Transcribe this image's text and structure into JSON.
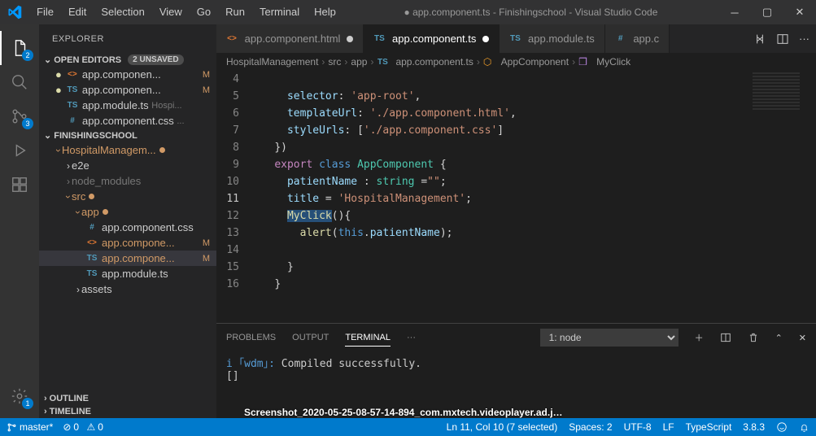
{
  "menu": {
    "items": [
      "File",
      "Edit",
      "Selection",
      "View",
      "Go",
      "Run",
      "Terminal",
      "Help"
    ]
  },
  "title": "● app.component.ts - Finishingschool - Visual Studio Code",
  "activity": {
    "explorer_badge": "2",
    "scm_badge": "3",
    "settings_badge": "1"
  },
  "sidebar": {
    "title": "EXPLORER",
    "open_editors": {
      "label": "OPEN EDITORS",
      "unsaved": "2 UNSAVED",
      "items": [
        {
          "dirty": true,
          "tag": "<>",
          "tagcls": "tag-html",
          "name": "app.componen...",
          "m": "M"
        },
        {
          "dirty": true,
          "tag": "TS",
          "tagcls": "tag-ts",
          "name": "app.componen...",
          "m": "M"
        },
        {
          "dirty": false,
          "tag": "TS",
          "tagcls": "tag-ts",
          "name": "app.module.ts",
          "suffix": "Hospi..."
        },
        {
          "dirty": false,
          "tag": "#",
          "tagcls": "tag-hash",
          "name": "app.component.css",
          "suffix": "..."
        }
      ]
    },
    "project": {
      "label": "FINISHINGSCHOOL",
      "root": "HospitalManagem...",
      "tree": {
        "e2e": "e2e",
        "node_modules": "node_modules",
        "src": "src",
        "app": "app",
        "files": [
          {
            "tag": "#",
            "tagcls": "tag-hash",
            "name": "app.component.css"
          },
          {
            "tag": "<>",
            "tagcls": "tag-html",
            "name": "app.compone...",
            "m": "M"
          },
          {
            "tag": "TS",
            "tagcls": "tag-ts",
            "name": "app.compone...",
            "m": "M",
            "selected": true
          },
          {
            "tag": "TS",
            "tagcls": "tag-ts",
            "name": "app.module.ts"
          }
        ],
        "assets": "assets"
      }
    },
    "outline": "OUTLINE",
    "timeline": "TIMELINE"
  },
  "tabs": {
    "items": [
      {
        "tag": "<>",
        "tagcls": "tag-html",
        "name": "app.component.html",
        "dirty": true,
        "active": false
      },
      {
        "tag": "TS",
        "tagcls": "tag-ts",
        "name": "app.component.ts",
        "dirty": true,
        "active": true
      },
      {
        "tag": "TS",
        "tagcls": "tag-ts",
        "name": "app.module.ts",
        "dirty": false,
        "active": false
      },
      {
        "tag": "#",
        "tagcls": "tag-hash",
        "name": "app.c",
        "dirty": false,
        "active": false
      }
    ]
  },
  "breadcrumb": [
    "HospitalManagement",
    "src",
    "app",
    "app.component.ts",
    "AppComponent",
    "MyClick"
  ],
  "code": {
    "lines": [
      4,
      5,
      6,
      7,
      8,
      9,
      10,
      11,
      12,
      13,
      14,
      15,
      16
    ],
    "current_line": 11,
    "l4": {
      "a": "selector",
      "b": ": ",
      "c": "'app-root'",
      "d": ","
    },
    "l5": {
      "a": "templateUrl",
      "b": ": ",
      "c": "'./app.component.html'",
      "d": ","
    },
    "l6": {
      "a": "styleUrls",
      "b": ": [",
      "c": "'./app.component.css'",
      "d": "]"
    },
    "l7": "})",
    "l8": {
      "a": "export",
      "b": "class",
      "c": "AppComponent",
      "d": "{"
    },
    "l9": {
      "a": "patientName",
      "b": " : ",
      "c": "string",
      "d": " =",
      "e": "\"\"",
      "f": ";"
    },
    "l10": {
      "a": "title",
      "b": " = ",
      "c": "'HospitalManagement'",
      "d": ";"
    },
    "l11": {
      "a": "MyClick",
      "b": "(){"
    },
    "l12": {
      "a": "alert",
      "b": "(",
      "c": "this",
      "d": ".",
      "e": "patientName",
      "f": ");"
    },
    "l14": "}",
    "l15": "}"
  },
  "panel": {
    "tabs": {
      "problems": "PROBLEMS",
      "output": "OUTPUT",
      "terminal": "TERMINAL"
    },
    "term_select": "1: node",
    "body_prefix": "i ｢wdm｣:",
    "body": " Compiled successfully.",
    "cursor": "[]"
  },
  "status": {
    "branch": "master*",
    "errors": "0",
    "warnings": "0",
    "pos": "Ln 11, Col 10 (7 selected)",
    "spaces": "Spaces: 2",
    "encoding": "UTF-8",
    "eol": "LF",
    "lang": "TypeScript",
    "tsver": "3.8.3"
  },
  "overlay": "Screenshot_2020-05-25-08-57-14-894_com.mxtech.videoplayer.ad.j…"
}
